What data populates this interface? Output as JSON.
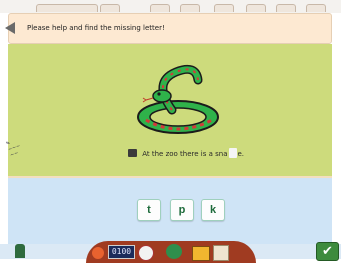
{
  "instruction": "Please help and find the missing letter!",
  "sentence": {
    "before": "At the zoo there is a sna",
    "after": "e."
  },
  "letter_choices": [
    "t",
    "p",
    "k"
  ],
  "dock": {
    "clock_text": "0100"
  },
  "colors": {
    "panel_green": "#cddb7c",
    "answer_blue": "#cfe4f6",
    "instruction_bg": "#fde9d2",
    "letter_green": "#1e6b3b"
  }
}
